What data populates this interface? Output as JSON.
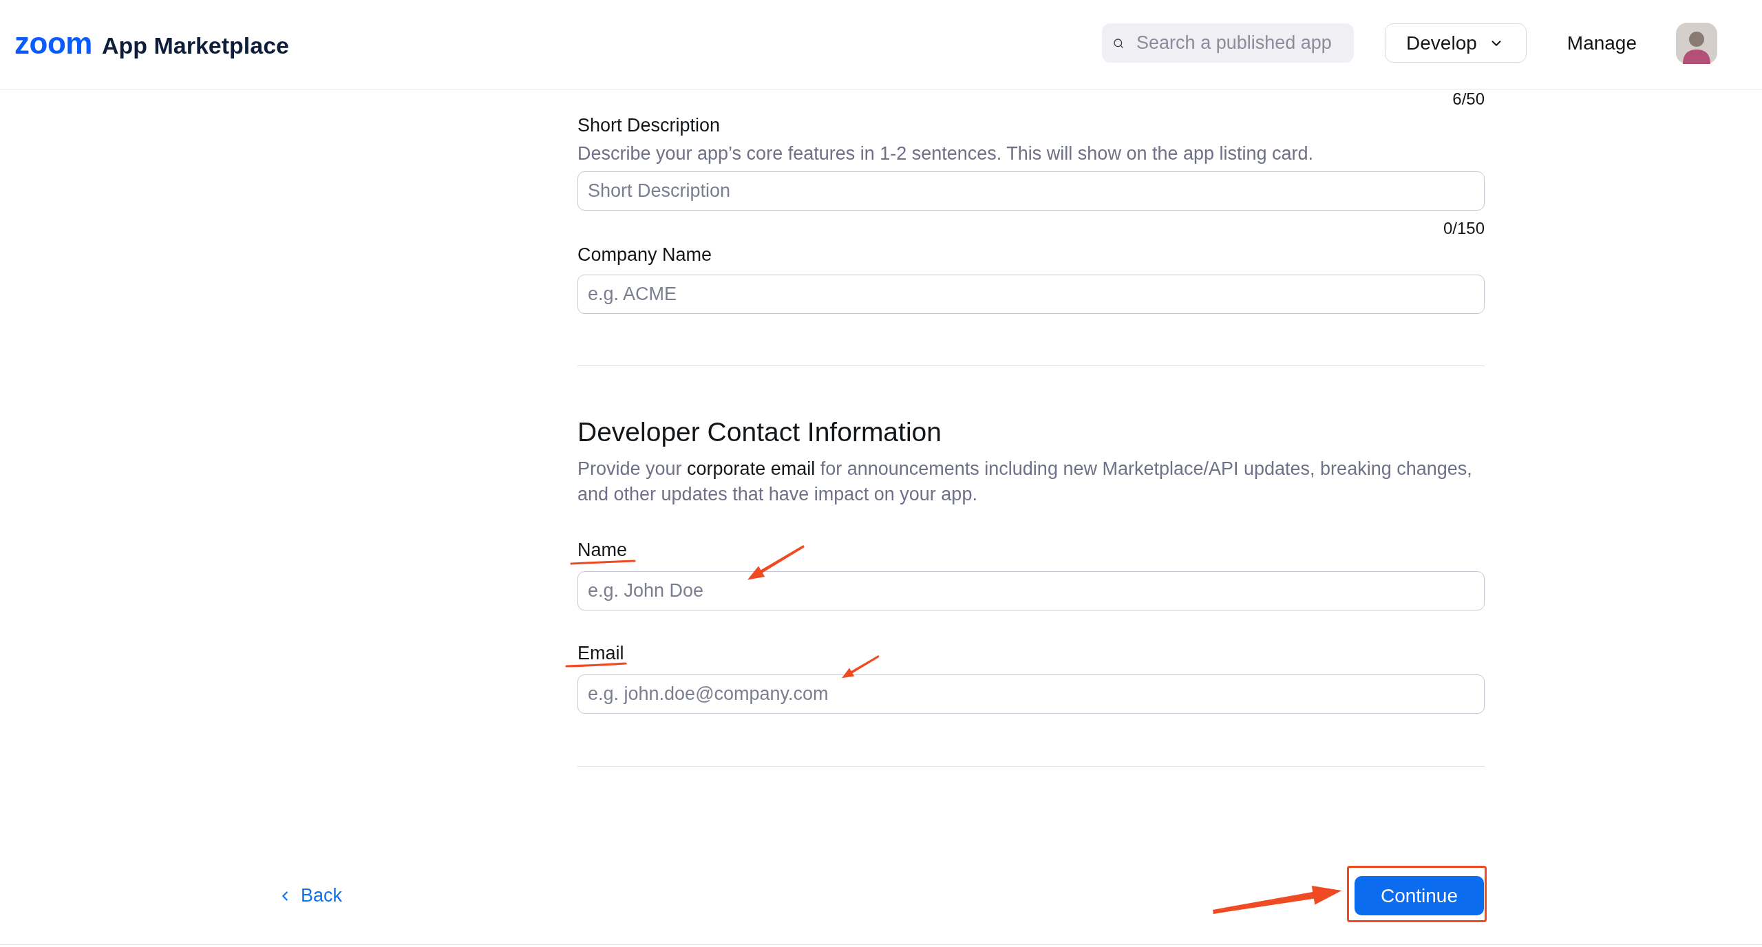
{
  "header": {
    "logo": "zoom",
    "title": "App Marketplace",
    "search": {
      "placeholder": "Search a published app"
    },
    "develop_menu": {
      "label": "Develop"
    },
    "manage_link": "Manage"
  },
  "form": {
    "counter": "6/50",
    "fields": [
      {
        "label": "Short Description",
        "hint": "Describe your app’s core features in 1-2 sentences. This will show on the app listing card.",
        "placeholder": "Short Description",
        "counter": "0/150"
      },
      {
        "label": "Company Name",
        "placeholder": "e.g. ACME"
      }
    ]
  },
  "contact": {
    "heading": "Developer Contact Information",
    "description": "Provide your **corporate email** for announcements including new Marketplace/API updates, breaking changes, and other updates that have impact on your app.",
    "fields": [
      {
        "label": "Name",
        "placeholder": "e.g. John Doe",
        "annotated": true
      },
      {
        "label": "Email",
        "placeholder": "e.g. john.doe@company.com",
        "annotated": true
      }
    ]
  },
  "footer": {
    "back_link": "Back",
    "continue_button": {
      "label": "Continue",
      "annotated": true
    }
  }
}
